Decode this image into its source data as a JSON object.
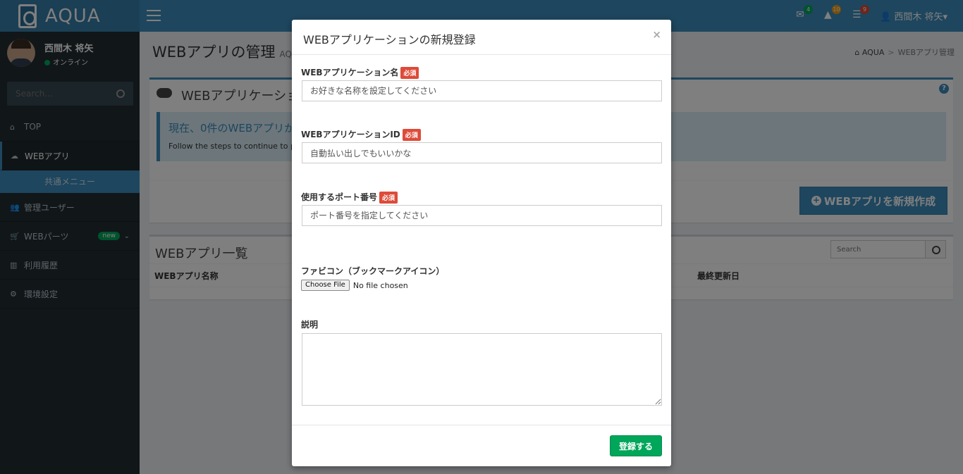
{
  "header": {
    "logo_text": "AQUA",
    "badges": {
      "mail": "4",
      "alert": "10",
      "tasks": "9"
    },
    "user_name": "西間木 将矢",
    "colors": {
      "header": "#3c8dbc",
      "logo_bg": "#367fa9",
      "sidebar": "#222d32"
    }
  },
  "sidebar": {
    "user_name": "西間木 将矢",
    "user_status": "オンライン",
    "search_placeholder": "Search...",
    "items": [
      {
        "label": "TOP",
        "icon": "home-icon"
      },
      {
        "label": "WEBアプリ",
        "icon": "cloud-icon"
      },
      {
        "label": "共通メニュー"
      },
      {
        "label": "管理ユーザー",
        "icon": "users-icon"
      },
      {
        "label": "WEBパーツ",
        "icon": "cart-icon",
        "badge": "new"
      },
      {
        "label": "利用履歴",
        "icon": "bar-chart-icon"
      },
      {
        "label": "環境設定",
        "icon": "gear-icon"
      }
    ]
  },
  "content": {
    "page_title": "WEBアプリの管理",
    "page_subtitle": "AQU",
    "breadcrumb": {
      "home": "AQUA",
      "current": "WEBアプリ管理"
    },
    "box1": {
      "title": "WEBアプリケーショ",
      "callout_title": "現在、0件のWEBアプリか",
      "callout_text": "Follow the steps to continue to pa",
      "create_button": "WEBアプリを新規作成"
    },
    "box2": {
      "title": "WEBアプリ一覧",
      "search_placeholder": "Search",
      "col_name": "WEBアプリ名称",
      "col_updated": "最終更新日"
    }
  },
  "modal": {
    "title": "WEBアプリケーションの新規登録",
    "close": "×",
    "fields": {
      "app_name": {
        "label": "WEBアプリケーション名",
        "required": "必須",
        "placeholder": "お好きな名称を設定してください"
      },
      "app_id": {
        "label": "WEBアプリケーションID",
        "required": "必須",
        "value": "自動払い出しでもいいかな"
      },
      "port": {
        "label": "使用するポート番号",
        "required": "必須",
        "placeholder": "ポート番号を指定してください"
      },
      "favicon": {
        "label": "ファビコン（ブックマークアイコン）",
        "button": "Choose File",
        "status": "No file chosen"
      },
      "description": {
        "label": "説明"
      }
    },
    "submit_label": "登録する",
    "submit_color": "#00a65a"
  }
}
